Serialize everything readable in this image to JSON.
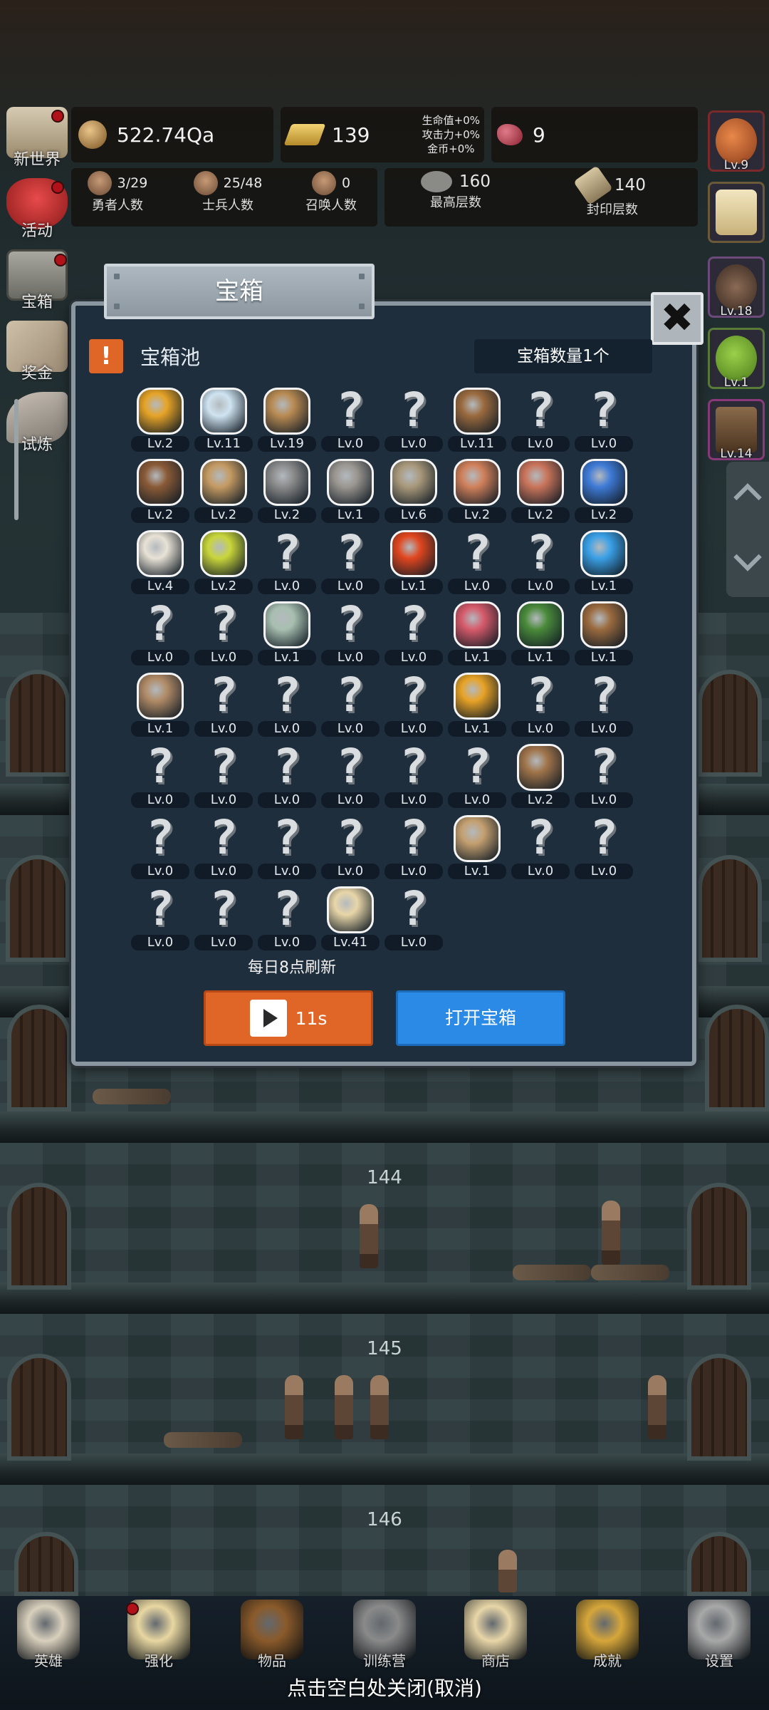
{
  "resources": {
    "gold": "522.74Qa",
    "bars": "139",
    "gems": "9",
    "bonus_hp": "生命值+0%",
    "bonus_atk": "攻击力+0%",
    "bonus_gold": "金币+0%"
  },
  "counts": [
    {
      "value": "3/29",
      "label": "勇者人数"
    },
    {
      "value": "25/48",
      "label": "士兵人数"
    },
    {
      "value": "0",
      "label": "召唤人数"
    },
    {
      "value": "160",
      "label": "最高层数"
    },
    {
      "value": "140",
      "label": "封印层数"
    }
  ],
  "side_menu": [
    {
      "label": "新世界",
      "icon": "map-scroll-icon",
      "dot": true
    },
    {
      "label": "活动",
      "icon": "heart-icon",
      "dot": true
    },
    {
      "label": "宝箱",
      "icon": "treasure-chest-icon",
      "dot": true
    },
    {
      "label": "奖金",
      "icon": "envelope-icon",
      "dot": false
    },
    {
      "label": "试炼",
      "icon": "wing-icon",
      "dot": false
    }
  ],
  "right_slots": [
    {
      "label": "Lv.9",
      "icon": "bomb-icon",
      "color": "#c8602c"
    },
    {
      "label": "",
      "icon": "candle-icon",
      "color": "#e8d7a2"
    },
    {
      "label": "Lv.18",
      "icon": "hooded-figure-icon",
      "color": "#6d5a4a"
    },
    {
      "label": "Lv.1",
      "icon": "green-slime-icon",
      "color": "#7ab23a"
    },
    {
      "label": "Lv.14",
      "icon": "box-creature-icon",
      "color": "#7a5a3a"
    }
  ],
  "modal": {
    "title": "宝箱",
    "close_symbol": "✖",
    "pool_title": "宝箱池",
    "pool_count": "宝箱数量1个",
    "refresh_note": "每日8点刷新",
    "video_button": "11s",
    "open_button": "打开宝箱"
  },
  "items": [
    {
      "lv": "Lv.2",
      "icon": "crown-icon",
      "color": "#e6a326"
    },
    {
      "lv": "Lv.11",
      "icon": "diamond-icon",
      "color": "#cfe3f0"
    },
    {
      "lv": "Lv.19",
      "icon": "sword-icon",
      "color": "#b88a52"
    },
    {
      "lv": "Lv.0",
      "icon": "unknown"
    },
    {
      "lv": "Lv.0",
      "icon": "unknown"
    },
    {
      "lv": "Lv.11",
      "icon": "leather-armor-icon",
      "color": "#9a6a3e"
    },
    {
      "lv": "Lv.0",
      "icon": "unknown"
    },
    {
      "lv": "Lv.0",
      "icon": "unknown"
    },
    {
      "lv": "Lv.2",
      "icon": "leather-helmet-icon",
      "color": "#8a5a36"
    },
    {
      "lv": "Lv.2",
      "icon": "dagger-icon",
      "color": "#c49a62"
    },
    {
      "lv": "Lv.2",
      "icon": "iron-helmet-icon",
      "color": "#8a8a8a"
    },
    {
      "lv": "Lv.1",
      "icon": "hammer-icon",
      "color": "#9a9690"
    },
    {
      "lv": "Lv.6",
      "icon": "great-helm-icon",
      "color": "#a8987a"
    },
    {
      "lv": "Lv.2",
      "icon": "drumstick-icon",
      "color": "#d0805a"
    },
    {
      "lv": "Lv.2",
      "icon": "steak-icon",
      "color": "#c9745a"
    },
    {
      "lv": "Lv.2",
      "icon": "blue-sack-icon",
      "color": "#3e7ad6"
    },
    {
      "lv": "Lv.4",
      "icon": "rice-bowl-icon",
      "color": "#e8e2d6"
    },
    {
      "lv": "Lv.2",
      "icon": "yellow-potion-icon",
      "color": "#c9d63a"
    },
    {
      "lv": "Lv.0",
      "icon": "unknown"
    },
    {
      "lv": "Lv.0",
      "icon": "unknown"
    },
    {
      "lv": "Lv.1",
      "icon": "red-potion-icon",
      "color": "#e0461e"
    },
    {
      "lv": "Lv.0",
      "icon": "unknown"
    },
    {
      "lv": "Lv.0",
      "icon": "unknown"
    },
    {
      "lv": "Lv.1",
      "icon": "blue-potion-icon",
      "color": "#3aa0e6"
    },
    {
      "lv": "Lv.0",
      "icon": "unknown"
    },
    {
      "lv": "Lv.0",
      "icon": "unknown"
    },
    {
      "lv": "Lv.1",
      "icon": "glass-bottle-icon",
      "color": "#a8bfb0"
    },
    {
      "lv": "Lv.0",
      "icon": "unknown"
    },
    {
      "lv": "Lv.0",
      "icon": "unknown"
    },
    {
      "lv": "Lv.1",
      "icon": "pink-vial-icon",
      "color": "#d65a6a"
    },
    {
      "lv": "Lv.1",
      "icon": "winged-boot-icon",
      "color": "#4a8a3a"
    },
    {
      "lv": "Lv.1",
      "icon": "leather-boot-icon",
      "color": "#9a6a3e"
    },
    {
      "lv": "Lv.1",
      "icon": "cloth-boot-icon",
      "color": "#b08a66"
    },
    {
      "lv": "Lv.0",
      "icon": "unknown"
    },
    {
      "lv": "Lv.0",
      "icon": "unknown"
    },
    {
      "lv": "Lv.0",
      "icon": "unknown"
    },
    {
      "lv": "Lv.0",
      "icon": "unknown"
    },
    {
      "lv": "Lv.1",
      "icon": "torch-icon",
      "color": "#e8a326"
    },
    {
      "lv": "Lv.0",
      "icon": "unknown"
    },
    {
      "lv": "Lv.0",
      "icon": "unknown"
    },
    {
      "lv": "Lv.0",
      "icon": "unknown"
    },
    {
      "lv": "Lv.0",
      "icon": "unknown"
    },
    {
      "lv": "Lv.0",
      "icon": "unknown"
    },
    {
      "lv": "Lv.0",
      "icon": "unknown"
    },
    {
      "lv": "Lv.0",
      "icon": "unknown"
    },
    {
      "lv": "Lv.0",
      "icon": "unknown"
    },
    {
      "lv": "Lv.2",
      "icon": "backpack-icon",
      "color": "#a0744a"
    },
    {
      "lv": "Lv.0",
      "icon": "unknown"
    },
    {
      "lv": "Lv.0",
      "icon": "unknown"
    },
    {
      "lv": "Lv.0",
      "icon": "unknown"
    },
    {
      "lv": "Lv.0",
      "icon": "unknown"
    },
    {
      "lv": "Lv.0",
      "icon": "unknown"
    },
    {
      "lv": "Lv.0",
      "icon": "unknown"
    },
    {
      "lv": "Lv.1",
      "icon": "bow-icon",
      "color": "#c4a070"
    },
    {
      "lv": "Lv.0",
      "icon": "unknown"
    },
    {
      "lv": "Lv.0",
      "icon": "unknown"
    },
    {
      "lv": "Lv.0",
      "icon": "unknown"
    },
    {
      "lv": "Lv.0",
      "icon": "unknown"
    },
    {
      "lv": "Lv.0",
      "icon": "unknown"
    },
    {
      "lv": "Lv.41",
      "icon": "beer-mug-icon",
      "color": "#e8d6a8"
    },
    {
      "lv": "Lv.0",
      "icon": "unknown"
    }
  ],
  "floors": [
    "144",
    "145",
    "146"
  ],
  "bottom_nav": [
    {
      "label": "英雄",
      "icon": "skull-icon",
      "color": "#d9d0bd",
      "dot": false
    },
    {
      "label": "强化",
      "icon": "candle-icon",
      "color": "#e8d7a2",
      "dot": true
    },
    {
      "label": "物品",
      "icon": "book-icon",
      "color": "#8a5a2a",
      "dot": false
    },
    {
      "label": "训练营",
      "icon": "lantern-icon",
      "color": "#8a8a8a",
      "dot": false
    },
    {
      "label": "商店",
      "icon": "beer-mug-icon",
      "color": "#e8d6a8",
      "dot": false
    },
    {
      "label": "成就",
      "icon": "key-icon",
      "color": "#d6a63a",
      "dot": false
    },
    {
      "label": "设置",
      "icon": "gear-icon",
      "color": "#a8a8a8",
      "dot": false
    }
  ],
  "close_hint": "点击空白处关闭(取消)"
}
